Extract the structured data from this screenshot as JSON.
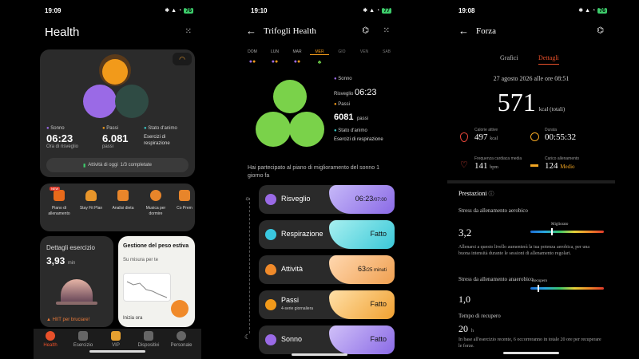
{
  "screen1": {
    "status": {
      "time": "19:09",
      "battery": "76"
    },
    "title": "Health",
    "metrics": {
      "sleep_label": "Sonno",
      "sleep_value": "06:23",
      "sleep_sub": "Ora di risveglio",
      "steps_label": "Passi",
      "steps_value": "6.081",
      "steps_sub": "passi",
      "mood_label": "Stato d'animo",
      "mood_sub": "Esercizi di respirazione"
    },
    "activity": {
      "label": "Attività di oggi",
      "value": "1/3 completate"
    },
    "services": [
      {
        "label": "Piano di allenamento",
        "badge": "NEW"
      },
      {
        "label": "Stay Fit Plan"
      },
      {
        "label": "Analisi dieta"
      },
      {
        "label": "Musica per dormire"
      },
      {
        "label": "Co Prem"
      }
    ],
    "exercise": {
      "title": "Dettagli esercizio",
      "value": "3,93",
      "unit": "min",
      "hint": "HIIT per bruciare!"
    },
    "weight": {
      "title": "Gestione del peso estiva",
      "sub": "Su misura per te",
      "cta": "Inizia ora"
    },
    "nav": [
      "Health",
      "Esercizio",
      "VIP",
      "Dispositivi",
      "Personale"
    ]
  },
  "screen2": {
    "status": {
      "time": "19:10",
      "battery": "77"
    },
    "title": "Trifogli Health",
    "days": [
      "DOM",
      "LUN",
      "MAR",
      "MER",
      "GIO",
      "VEN",
      "SAB"
    ],
    "active_day": "MER",
    "legend": {
      "sleep_label": "Sonno",
      "wake_label": "Risveglio",
      "wake_value": "06:23",
      "steps_label": "Passi",
      "steps_value": "6081",
      "steps_unit": "passi",
      "mood_label": "Stato d'animo",
      "mood_sub": "Esercizi di respirazione"
    },
    "plan_text": "Hai partecipato al piano di miglioramento del sonno 1 giorno fa",
    "tasks": [
      {
        "label": "Risveglio",
        "value": "06:23",
        "value_sub": "/07:00"
      },
      {
        "label": "Respirazione",
        "value": "Fatto"
      },
      {
        "label": "Attività",
        "value": "63",
        "value_sub": "/25 minuti"
      },
      {
        "label": "Passi",
        "sub": "4-serie giornaliera",
        "value": "Fatto"
      },
      {
        "label": "Sonno",
        "value": "Fatto"
      }
    ]
  },
  "screen3": {
    "status": {
      "time": "19:08",
      "battery": "76"
    },
    "title": "Forza",
    "tabs": [
      "Grafici",
      "Dettagli"
    ],
    "active_tab": "Dettagli",
    "date": "27 agosto 2026 alle ore 08:51",
    "total": {
      "value": "571",
      "unit": "kcal (totali)"
    },
    "stats": [
      {
        "label": "Calorie attive",
        "value": "497",
        "unit": "kcal",
        "color": "#e8463a"
      },
      {
        "label": "Durata",
        "value": "00:55:32",
        "unit": "",
        "color": "#f2a623"
      },
      {
        "label": "Frequenza cardiaca media",
        "value": "141",
        "unit": "bpm",
        "color": "#e8463a"
      },
      {
        "label": "Carico allenamento",
        "value": "124",
        "unit": "Medio",
        "color": "#f2a623"
      }
    ],
    "section": "Prestazioni",
    "aerobic": {
      "label": "Stress da allenamento aerobico",
      "value": "3,2",
      "tag": "Migliorato",
      "level": 0.28,
      "desc": "Allenarsi a questo livello aumenterà la tua potenza aerobica, per una buona intensità durante le sessioni di allenamento regolari."
    },
    "anaerobic": {
      "label": "Stress da allenamento anaerobico",
      "value": "1,0",
      "tag": "Recupero",
      "level": 0.1
    },
    "recovery": {
      "label": "Tempo di recupero",
      "value": "20",
      "unit": "h",
      "desc": "In base all'esercizio recente, 6 occorreranno in totale 20 ore per recuperare le forze."
    }
  }
}
